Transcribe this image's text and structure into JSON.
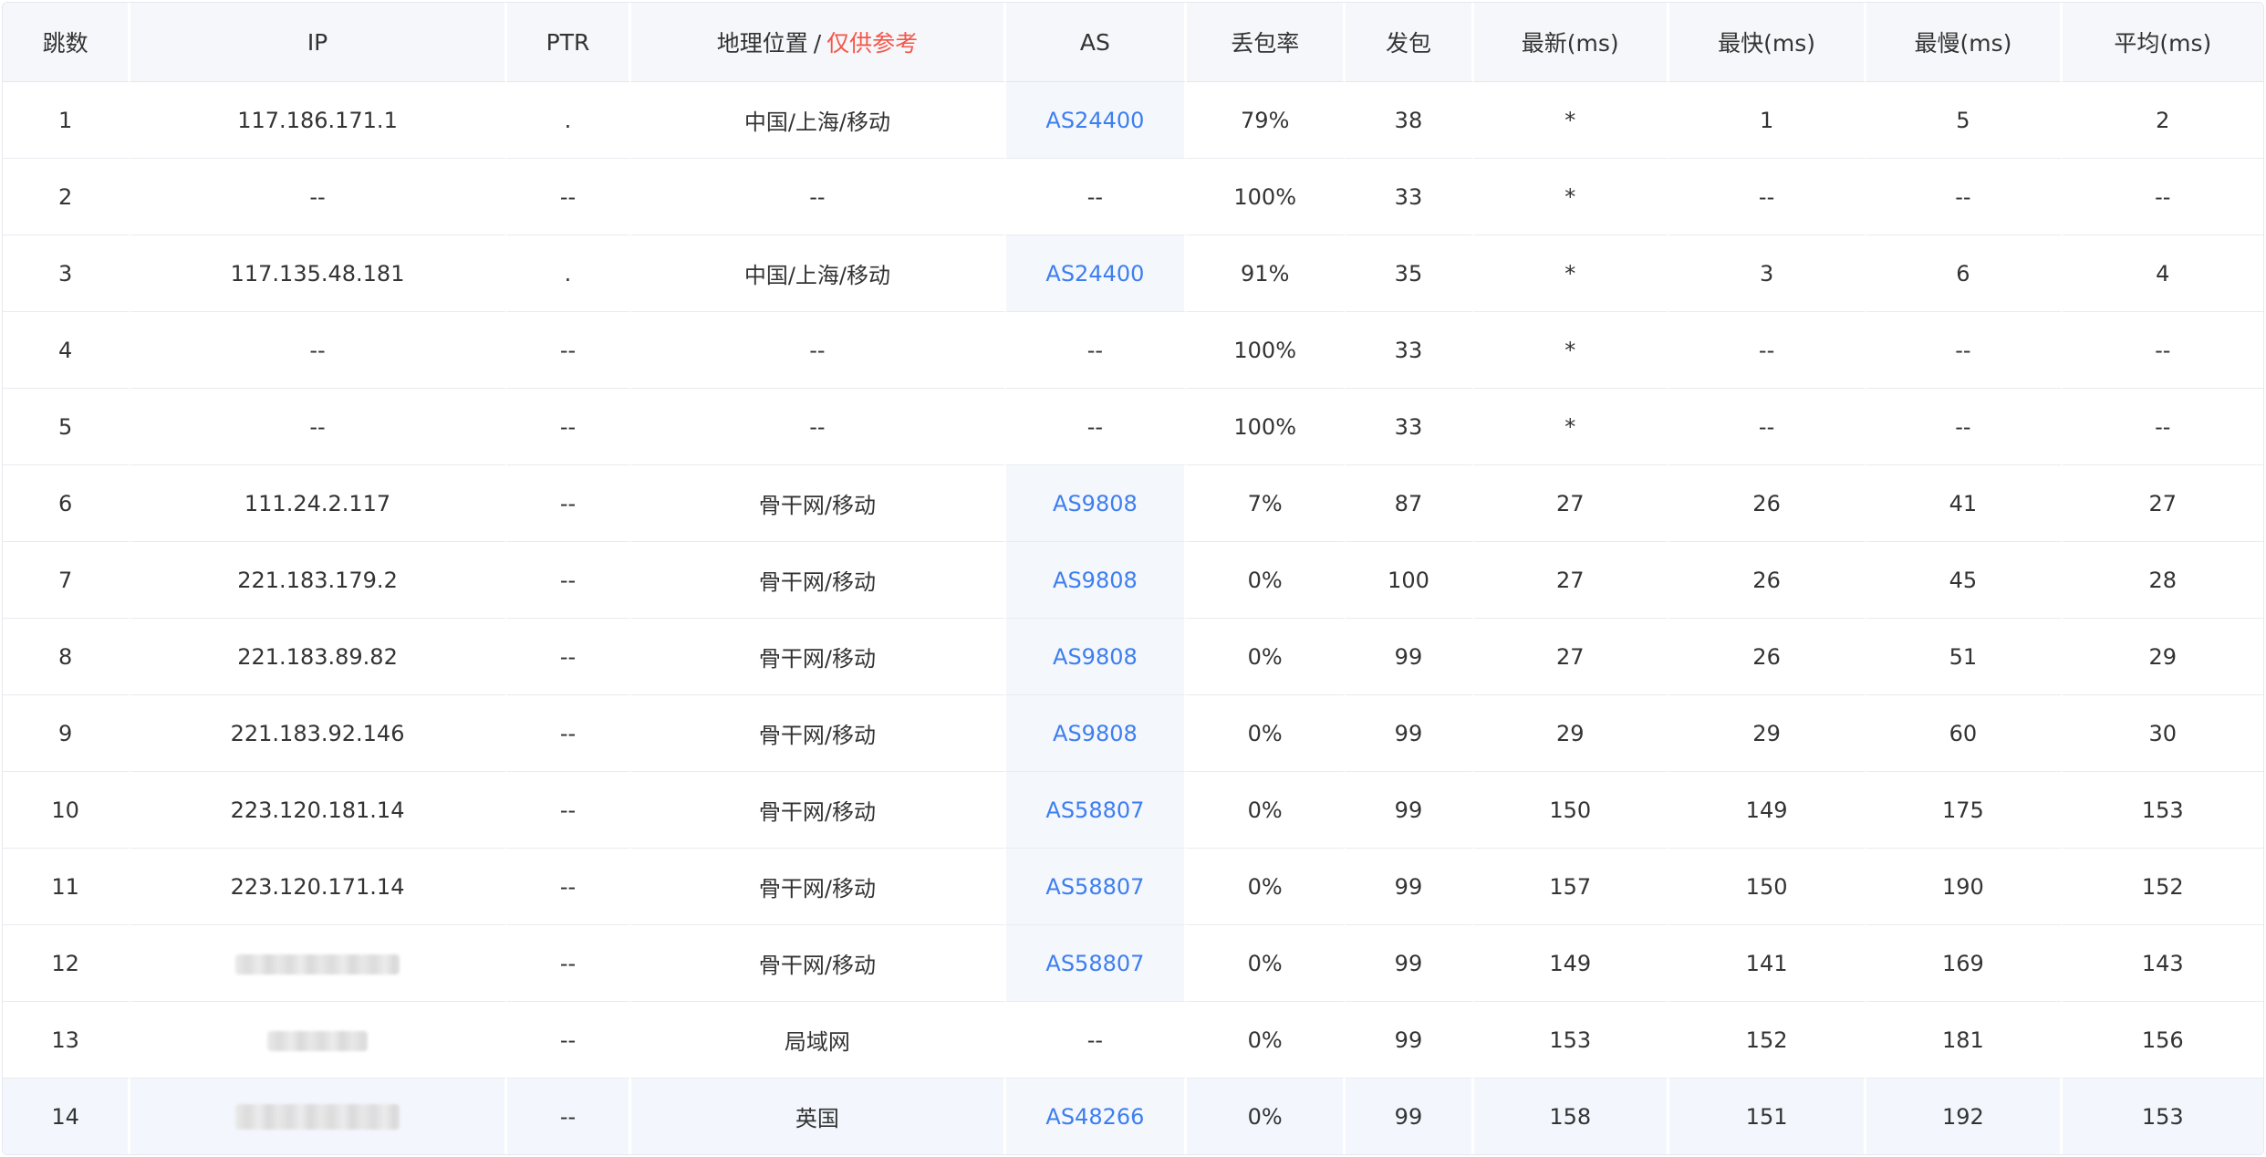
{
  "headers": {
    "hop": "跳数",
    "ip": "IP",
    "ptr": "PTR",
    "geo": "地理位置",
    "geo_sep": "/",
    "geo_note": "仅供参考",
    "as": "AS",
    "loss": "丢包率",
    "sent": "发包",
    "last": "最新(ms)",
    "best": "最快(ms)",
    "worst": "最慢(ms)",
    "avg": "平均(ms)"
  },
  "rows": [
    {
      "hop": "1",
      "ip": "117.186.171.1",
      "ptr": ".",
      "geo": "中国/上海/移动",
      "as": "AS24400",
      "loss": "79%",
      "sent": "38",
      "last": "*",
      "best": "1",
      "worst": "5",
      "avg": "2"
    },
    {
      "hop": "2",
      "ip": "--",
      "ptr": "--",
      "geo": "--",
      "as": "--",
      "loss": "100%",
      "sent": "33",
      "last": "*",
      "best": "--",
      "worst": "--",
      "avg": "--"
    },
    {
      "hop": "3",
      "ip": "117.135.48.181",
      "ptr": ".",
      "geo": "中国/上海/移动",
      "as": "AS24400",
      "loss": "91%",
      "sent": "35",
      "last": "*",
      "best": "3",
      "worst": "6",
      "avg": "4"
    },
    {
      "hop": "4",
      "ip": "--",
      "ptr": "--",
      "geo": "--",
      "as": "--",
      "loss": "100%",
      "sent": "33",
      "last": "*",
      "best": "--",
      "worst": "--",
      "avg": "--"
    },
    {
      "hop": "5",
      "ip": "--",
      "ptr": "--",
      "geo": "--",
      "as": "--",
      "loss": "100%",
      "sent": "33",
      "last": "*",
      "best": "--",
      "worst": "--",
      "avg": "--"
    },
    {
      "hop": "6",
      "ip": "111.24.2.117",
      "ptr": "--",
      "geo": "骨干网/移动",
      "as": "AS9808",
      "loss": "7%",
      "sent": "87",
      "last": "27",
      "best": "26",
      "worst": "41",
      "avg": "27"
    },
    {
      "hop": "7",
      "ip": "221.183.179.2",
      "ptr": "--",
      "geo": "骨干网/移动",
      "as": "AS9808",
      "loss": "0%",
      "sent": "100",
      "last": "27",
      "best": "26",
      "worst": "45",
      "avg": "28"
    },
    {
      "hop": "8",
      "ip": "221.183.89.82",
      "ptr": "--",
      "geo": "骨干网/移动",
      "as": "AS9808",
      "loss": "0%",
      "sent": "99",
      "last": "27",
      "best": "26",
      "worst": "51",
      "avg": "29"
    },
    {
      "hop": "9",
      "ip": "221.183.92.146",
      "ptr": "--",
      "geo": "骨干网/移动",
      "as": "AS9808",
      "loss": "0%",
      "sent": "99",
      "last": "29",
      "best": "29",
      "worst": "60",
      "avg": "30"
    },
    {
      "hop": "10",
      "ip": "223.120.181.14",
      "ptr": "--",
      "geo": "骨干网/移动",
      "as": "AS58807",
      "loss": "0%",
      "sent": "99",
      "last": "150",
      "best": "149",
      "worst": "175",
      "avg": "153"
    },
    {
      "hop": "11",
      "ip": "223.120.171.14",
      "ptr": "--",
      "geo": "骨干网/移动",
      "as": "AS58807",
      "loss": "0%",
      "sent": "99",
      "last": "157",
      "best": "150",
      "worst": "190",
      "avg": "152"
    },
    {
      "hop": "12",
      "ip": "",
      "ptr": "--",
      "geo": "骨干网/移动",
      "as": "AS58807",
      "loss": "0%",
      "sent": "99",
      "last": "149",
      "best": "141",
      "worst": "169",
      "avg": "143"
    },
    {
      "hop": "13",
      "ip": "",
      "ptr": "--",
      "geo": "局域网",
      "as": "--",
      "loss": "0%",
      "sent": "99",
      "last": "153",
      "best": "152",
      "worst": "181",
      "avg": "156"
    },
    {
      "hop": "14",
      "ip": "",
      "ptr": "--",
      "geo": "英国",
      "as": "AS48266",
      "loss": "0%",
      "sent": "99",
      "last": "158",
      "best": "151",
      "worst": "192",
      "avg": "153"
    }
  ],
  "colors": {
    "link": "#3d7ef0",
    "warning": "#f5564a",
    "header_bg": "#f5f7fa",
    "hover_row_bg": "#f3f7fd"
  }
}
